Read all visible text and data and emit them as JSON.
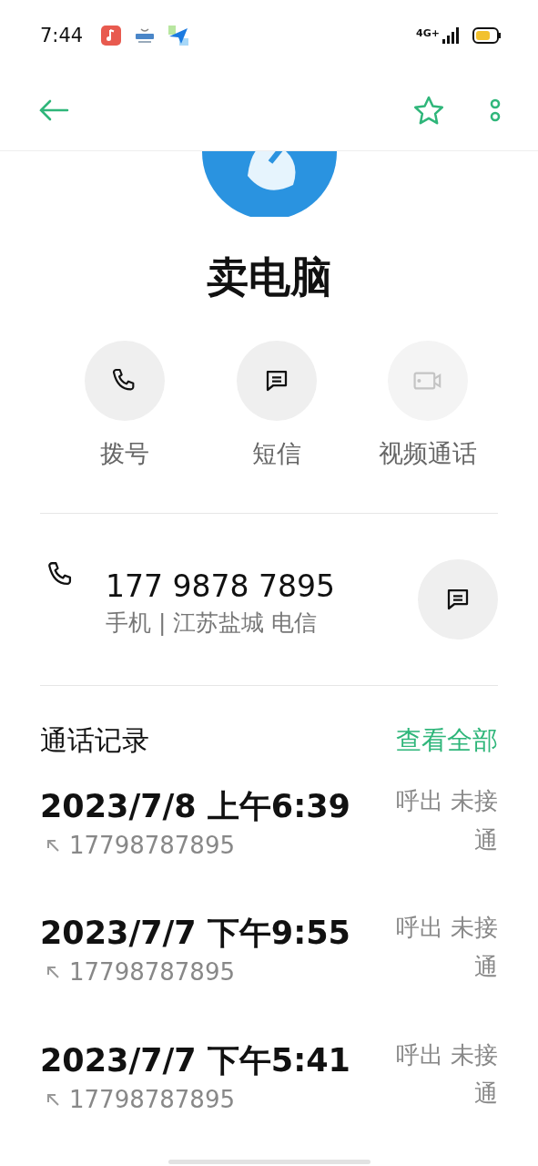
{
  "status_bar": {
    "time": "7:44",
    "network": "4G+"
  },
  "contact": {
    "name": "卖电脑"
  },
  "actions": [
    {
      "kind": "call",
      "label": "拨号",
      "disabled": false
    },
    {
      "kind": "message",
      "label": "短信",
      "disabled": false
    },
    {
      "kind": "video",
      "label": "视频通话",
      "disabled": true
    }
  ],
  "phone": {
    "number": "177 9878 7895",
    "detail": "手机 | 江苏盐城 电信"
  },
  "call_log": {
    "title": "通话记录",
    "link": "查看全部",
    "entries": [
      {
        "datetime": "2023/7/8 上午6:39",
        "number": "17798787895",
        "status": "呼出 未接通"
      },
      {
        "datetime": "2023/7/7 下午9:55",
        "number": "17798787895",
        "status": "呼出 未接通"
      },
      {
        "datetime": "2023/7/7 下午5:41",
        "number": "17798787895",
        "status": "呼出 未接通"
      }
    ]
  }
}
